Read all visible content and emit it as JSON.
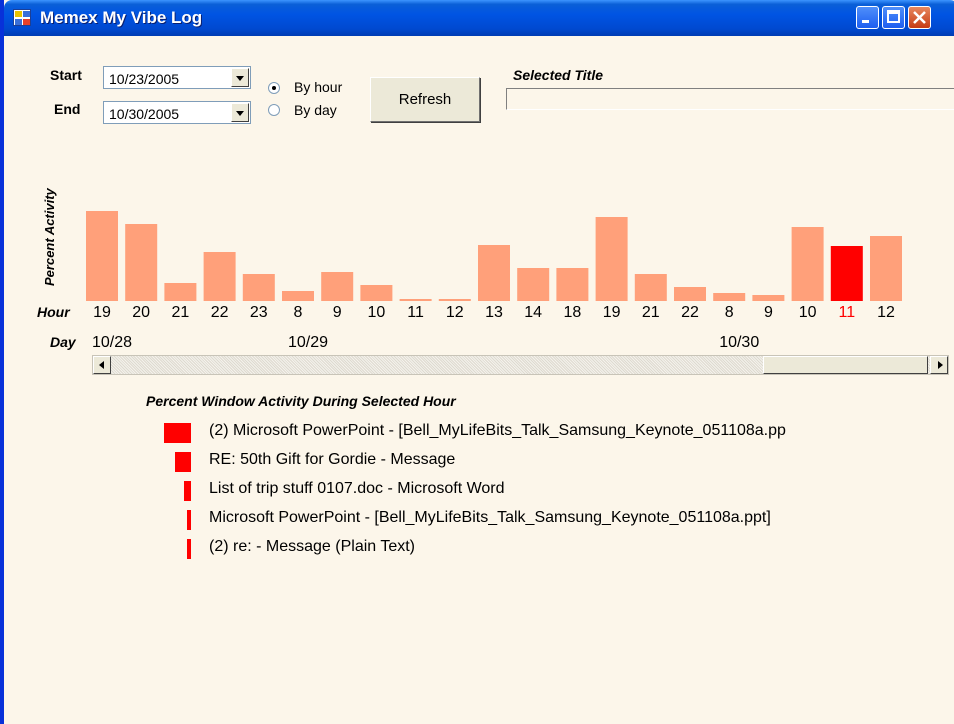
{
  "window": {
    "title": "Memex My Vibe Log"
  },
  "controls": {
    "start_label": "Start",
    "start_date": "10/23/2005",
    "end_label": "End",
    "end_date": "10/30/2005",
    "mode_options": [
      {
        "label": "By hour",
        "selected": true
      },
      {
        "label": "By day",
        "selected": false
      }
    ],
    "refresh_label": "Refresh",
    "selected_title_label": "Selected Title",
    "selected_title_value": ""
  },
  "chart_data": {
    "type": "bar",
    "ylabel": "Percent Activity",
    "x_axis_label": "Hour",
    "day_axis_label": "Day",
    "categories": [
      "19",
      "20",
      "21",
      "22",
      "23",
      "8",
      "9",
      "10",
      "11",
      "12",
      "13",
      "14",
      "18",
      "19",
      "21",
      "22",
      "8",
      "9",
      "10",
      "11",
      "12"
    ],
    "values": [
      90,
      77,
      18,
      49,
      27,
      10,
      29,
      16,
      2,
      2,
      56,
      33,
      33,
      84,
      27,
      14,
      8,
      6,
      74,
      55,
      65
    ],
    "days": [
      {
        "label": "10/28",
        "start_index": 0
      },
      {
        "label": "10/29",
        "start_index": 5
      },
      {
        "label": "10/30",
        "start_index": 16
      }
    ],
    "selected_index": 19,
    "bar_color": "#ffa07a",
    "selected_color": "#ff0000",
    "selected_tick_color": "#ff0000"
  },
  "activity": {
    "title": "Percent Window Activity During Selected Hour",
    "bar_color": "#ff0000",
    "items": [
      {
        "label": "(2) Microsoft PowerPoint - [Bell_MyLifeBits_Talk_Samsung_Keynote_051108a.pp",
        "percent": 38
      },
      {
        "label": "RE: 50th Gift for Gordie - Message",
        "percent": 22
      },
      {
        "label": "List of trip stuff 0107.doc - Microsoft Word",
        "percent": 10
      },
      {
        "label": "Microsoft PowerPoint - [Bell_MyLifeBits_Talk_Samsung_Keynote_051108a.ppt]",
        "percent": 5
      },
      {
        "label": "(2) re: - Message (Plain Text)",
        "percent": 5
      }
    ]
  }
}
